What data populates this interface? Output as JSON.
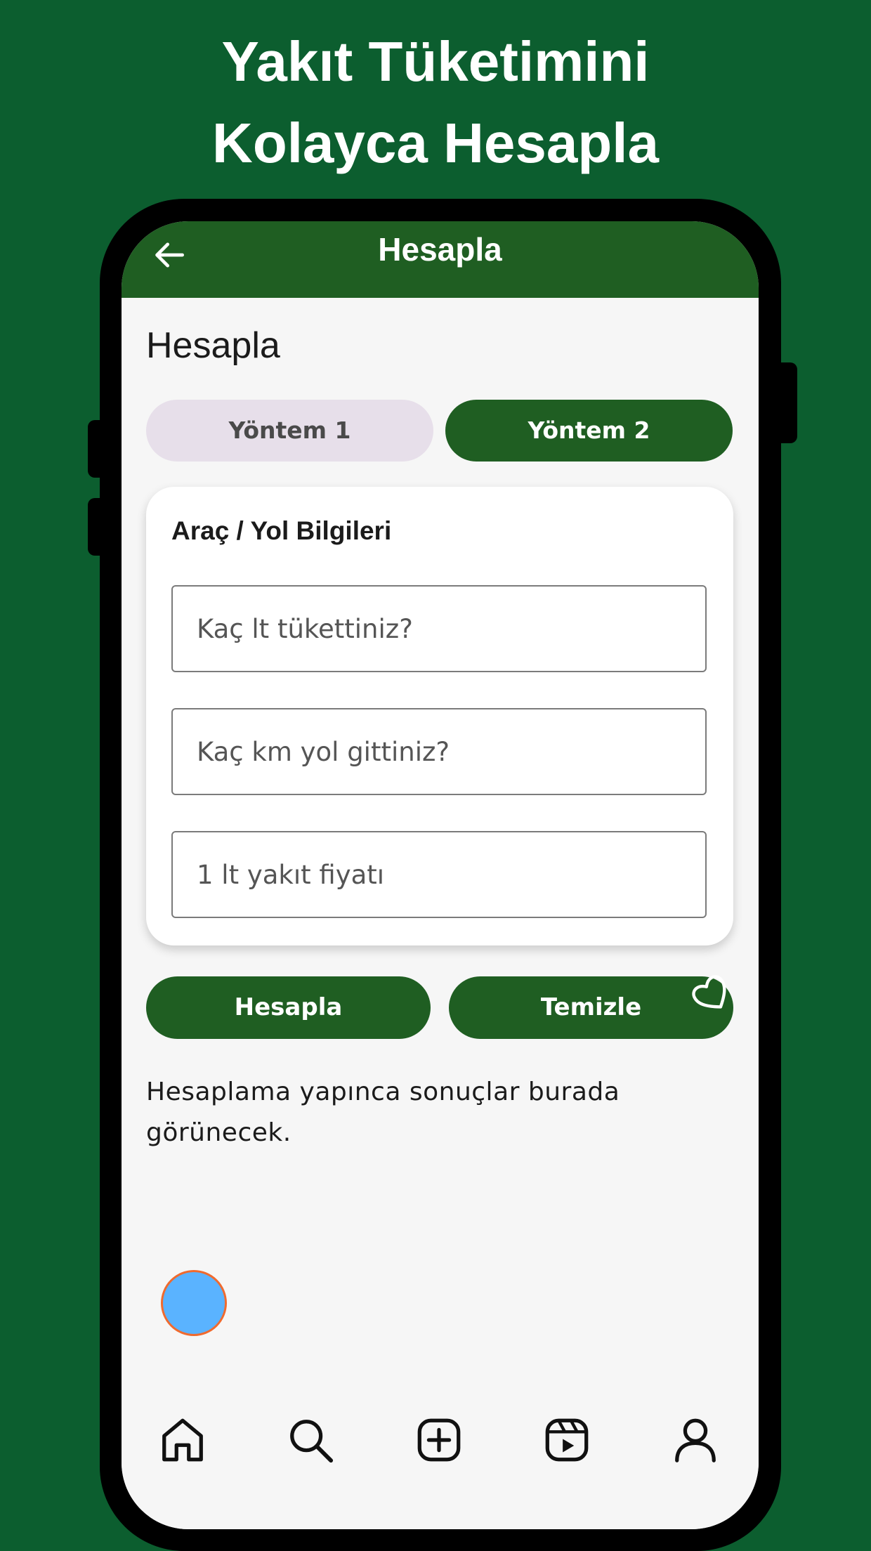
{
  "promo": {
    "line1": "Yakıt Tüketimini",
    "line2": "Kolayca Hesapla"
  },
  "appbar": {
    "title": "Hesapla",
    "back_icon": "arrow-back-icon"
  },
  "page": {
    "title": "Hesapla"
  },
  "segments": [
    {
      "label": "Yöntem 1",
      "selected": false
    },
    {
      "label": "Yöntem 2",
      "selected": true
    }
  ],
  "card": {
    "title": "Araç / Yol Bilgileri",
    "fields": [
      {
        "placeholder": "Kaç lt tükettiniz?",
        "value": ""
      },
      {
        "placeholder": "Kaç km yol gittiniz?",
        "value": ""
      },
      {
        "placeholder": "1 lt yakıt fiyatı",
        "value": ""
      }
    ]
  },
  "actions": {
    "calculate_label": "Hesapla",
    "clear_label": "Temizle"
  },
  "result": {
    "text": "Hesaplama yapınca sonuçlar burada görünecek."
  },
  "bottom_nav": [
    {
      "icon": "home-icon"
    },
    {
      "icon": "search-icon"
    },
    {
      "icon": "add-icon"
    },
    {
      "icon": "reels-icon"
    },
    {
      "icon": "profile-icon"
    }
  ],
  "colors": {
    "background": "#0c5e2f",
    "primary": "#1f5e22",
    "segment_inactive": "#e7dfea",
    "fab": "#5ab3ff",
    "fab_border": "#f06a2e"
  }
}
